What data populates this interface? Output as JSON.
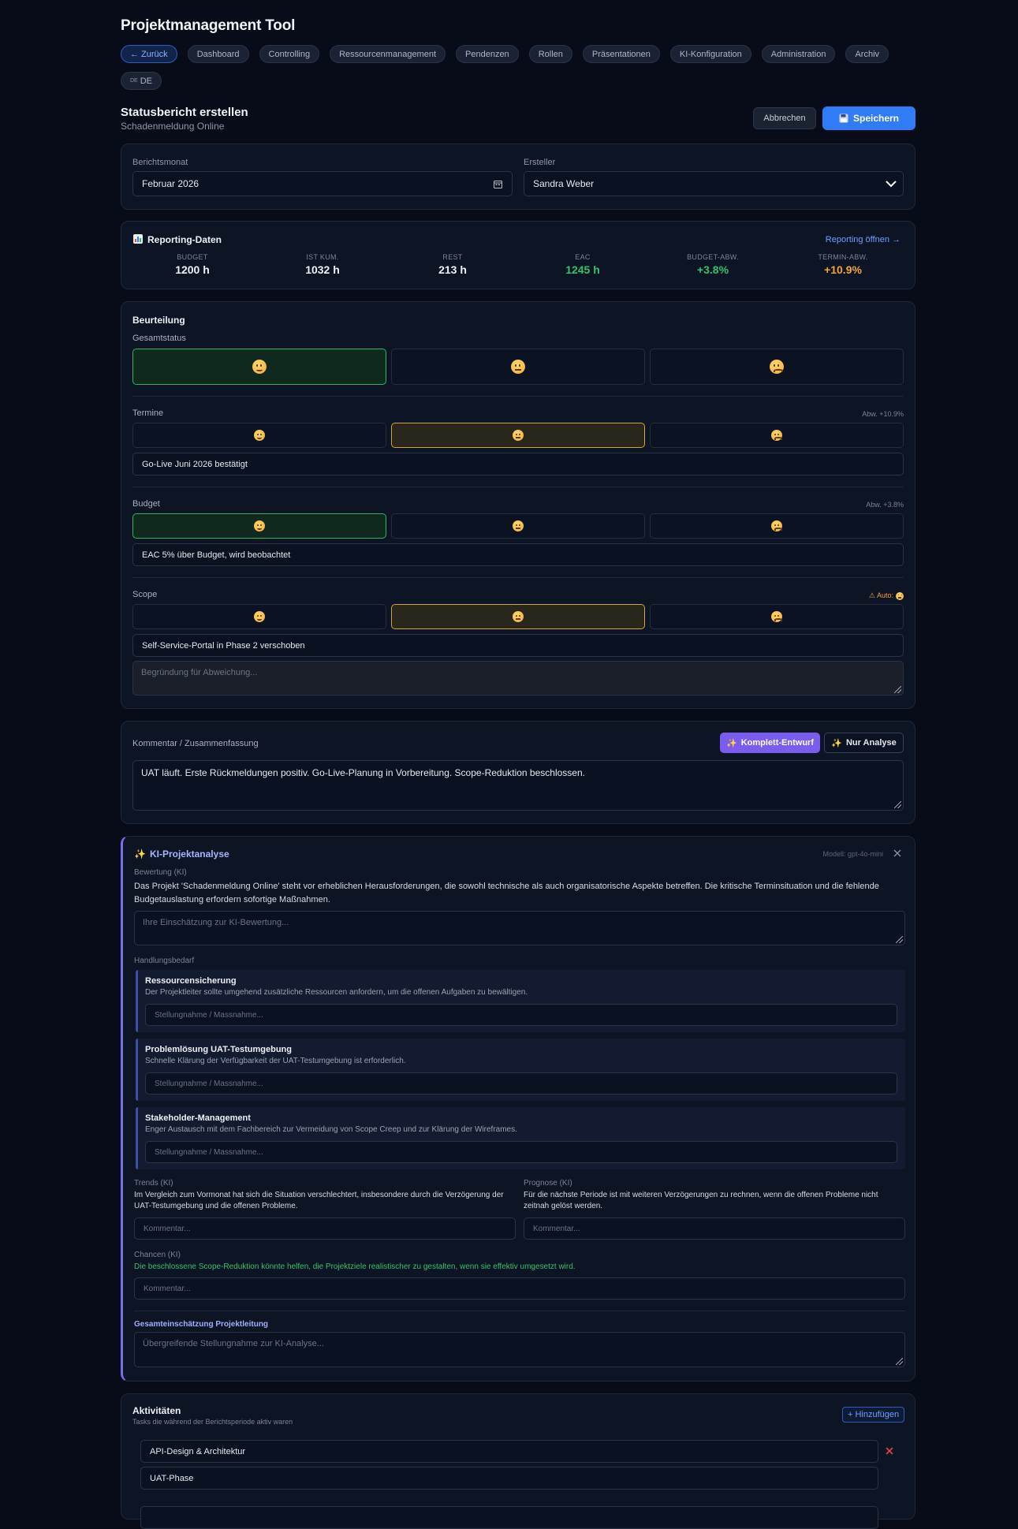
{
  "app_title": "Projektmanagement Tool",
  "nav": [
    {
      "label": "← Zurück"
    },
    {
      "label": "Dashboard"
    },
    {
      "label": "Controlling"
    },
    {
      "label": "Ressourcenmanagement"
    },
    {
      "label": "Pendenzen"
    },
    {
      "label": "Rollen"
    },
    {
      "label": "Präsentationen"
    },
    {
      "label": "KI-Konfiguration"
    },
    {
      "label": "Administration"
    },
    {
      "label": "Archiv"
    }
  ],
  "lang": {
    "flag": "DE",
    "label": "DE"
  },
  "header": {
    "title": "Statusbericht erstellen",
    "subtitle": "Schadenmeldung Online",
    "cancel_label": "Abbrechen",
    "save_label": "Speichern",
    "save_icon": "floppy-disk-icon"
  },
  "form": {
    "month_label": "Berichtsmonat",
    "month_value": "Februar 2026",
    "author_label": "Ersteller",
    "author_value": "Sandra Weber"
  },
  "reporting": {
    "title": "Reporting-Daten",
    "link": "Reporting öffnen →",
    "kpis": [
      {
        "key": "BUDGET",
        "value": "1200 h",
        "color": "#eef1f6"
      },
      {
        "key": "IST KUM.",
        "value": "1032 h",
        "color": "#eef1f6"
      },
      {
        "key": "REST",
        "value": "213 h",
        "color": "#eef1f6"
      },
      {
        "key": "EAC",
        "value": "1245 h",
        "color": "#2fc46a"
      },
      {
        "key": "BUDGET-ABW.",
        "value": "+3.8%",
        "color": "#2fc46a"
      },
      {
        "key": "TERMIN-ABW.",
        "value": "+10.9%",
        "color": "#f2a43a"
      }
    ]
  },
  "assessment": {
    "title": "Beurteilung",
    "overall_label": "Gesamtstatus",
    "termine_label": "Termine",
    "termine_abw": "Abw. +10.9%",
    "termine_note": "Go-Live Juni 2026 bestätigt",
    "budget_label": "Budget",
    "budget_abw": "Abw. +3.8%",
    "budget_note": "EAC 5% über Budget, wird beobachtet",
    "scope_label": "Scope",
    "scope_auto": "⚠ Auto:",
    "scope_note": "Self-Service-Portal in Phase 2 verschoben",
    "reason_placeholder": "Begründung für Abweichung..."
  },
  "comment": {
    "label": "Kommentar / Zusammenfassung",
    "btn_full": "Komplett-Entwurf",
    "btn_analysis": "Nur Analyse",
    "text": "UAT läuft. Erste Rückmeldungen positiv. Go-Live-Planung in Vorbereitung. Scope-Reduktion beschlossen."
  },
  "ki": {
    "title": "KI-Projektanalyse",
    "model": "Modell: gpt-4o-mini",
    "rating_label": "Bewertung (KI)",
    "rating_text": "Das Projekt 'Schadenmeldung Online' steht vor erheblichen Herausforderungen, die sowohl technische als auch organisatorische Aspekte betreffen. Die kritische Terminsituation und die fehlende Budgetauslastung erfordern sofortige Maßnahmen.",
    "rating_placeholder": "Ihre Einschätzung zur KI-Bewertung...",
    "needs_label": "Handlungsbedarf",
    "actions": [
      {
        "title": "Ressourcensicherung",
        "desc": "Der Projektleiter sollte umgehend zusätzliche Ressourcen anfordern, um die offenen Aufgaben zu bewältigen.",
        "placeholder": "Stellungnahme / Massnahme..."
      },
      {
        "title": "Problemlösung UAT-Testumgebung",
        "desc": "Schnelle Klärung der Verfügbarkeit der UAT-Testumgebung ist erforderlich.",
        "placeholder": "Stellungnahme / Massnahme..."
      },
      {
        "title": "Stakeholder-Management",
        "desc": "Enger Austausch mit dem Fachbereich zur Vermeidung von Scope Creep und zur Klärung der Wireframes.",
        "placeholder": "Stellungnahme / Massnahme..."
      }
    ],
    "trends_label": "Trends (KI)",
    "trends_text": "Im Vergleich zum Vormonat hat sich die Situation verschlechtert, insbesondere durch die Verzögerung der UAT-Testumgebung und die offenen Probleme.",
    "forecast_label": "Prognose (KI)",
    "forecast_text": "Für die nächste Periode ist mit weiteren Verzögerungen zu rechnen, wenn die offenen Probleme nicht zeitnah gelöst werden.",
    "comment_placeholder": "Kommentar...",
    "chances_label": "Chancen (KI)",
    "chances_text": "Die beschlossene Scope-Reduktion könnte helfen, die Projektziele realistischer zu gestalten, wenn sie effektiv umgesetzt wird.",
    "overall_label": "Gesamteinschätzung Projektleitung",
    "overall_placeholder": "Übergreifende Stellungnahme zur KI-Analyse..."
  },
  "activities": {
    "title": "Aktivitäten",
    "subtitle": "Tasks die während der Berichtsperiode aktiv waren",
    "add_label": "+ Hinzufügen",
    "items": [
      "API-Design & Architektur",
      "UAT-Phase"
    ]
  },
  "colors": {
    "accent": "#2f7cf6",
    "green": "#2fc46a",
    "amber": "#f2a43a",
    "purple": "#7a5cf0"
  }
}
